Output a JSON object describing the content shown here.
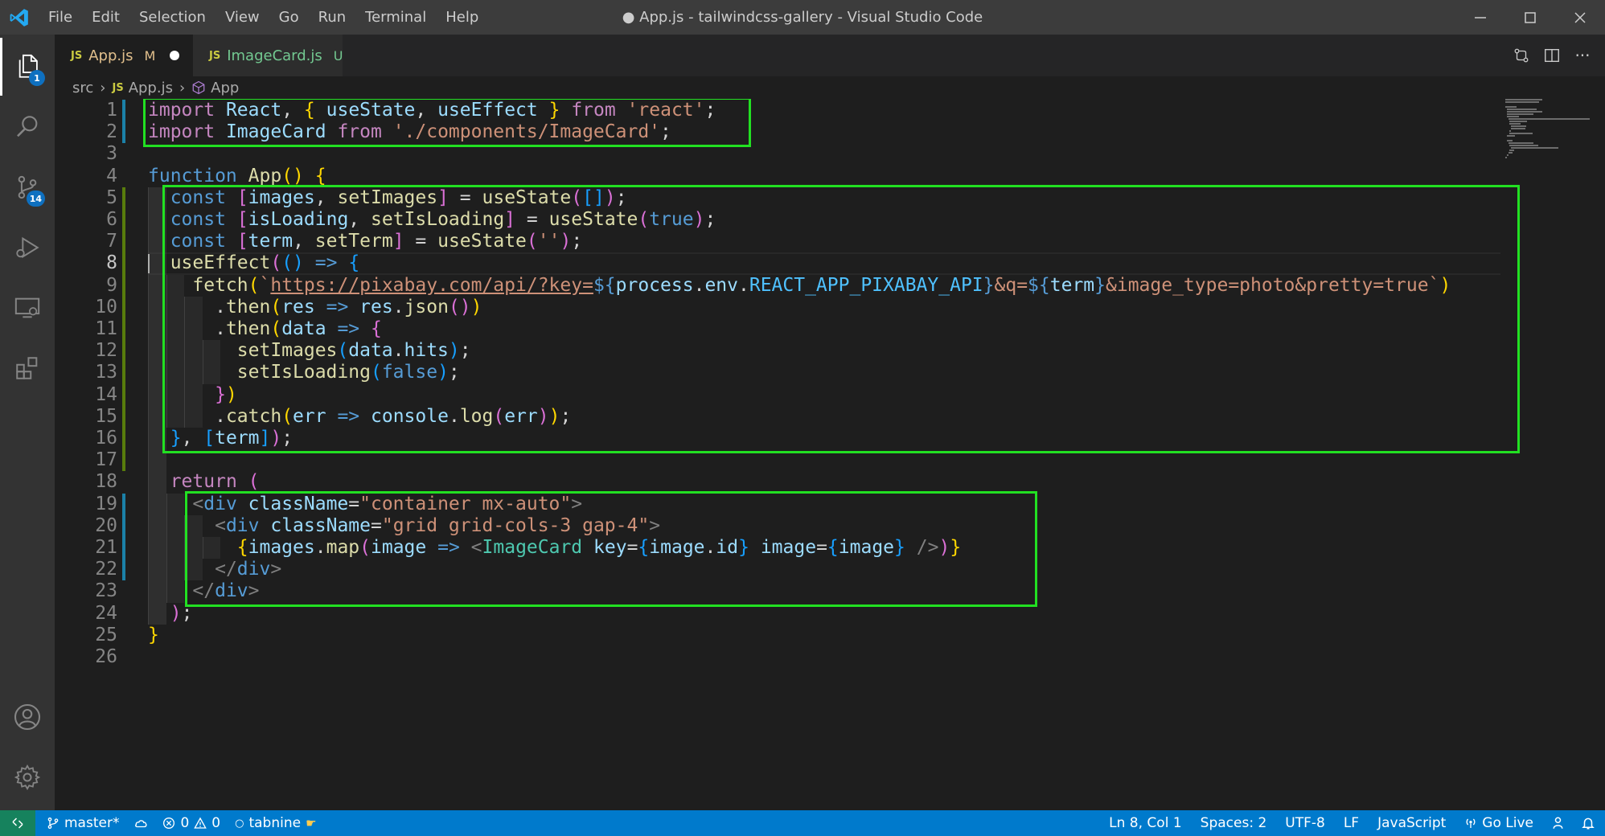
{
  "window": {
    "title": "● App.js - tailwindcss-gallery - Visual Studio Code"
  },
  "menu": [
    "File",
    "Edit",
    "Selection",
    "View",
    "Go",
    "Run",
    "Terminal",
    "Help"
  ],
  "activity_bar": {
    "explorer_badge": "1",
    "source_control_badge": "14",
    "items": [
      "explorer-icon",
      "search-icon",
      "source-control-icon",
      "run-debug-icon",
      "remote-explorer-icon",
      "extensions-icon",
      "account-icon",
      "manage-gear-icon"
    ]
  },
  "tabs": [
    {
      "icon": "JS",
      "label": "App.js",
      "status": "M",
      "dirty": true,
      "active": true
    },
    {
      "icon": "JS",
      "label": "ImageCard.js",
      "status": "U",
      "dirty": false,
      "active": false
    }
  ],
  "tab_actions": {
    "more": "···"
  },
  "breadcrumb": {
    "folder": "src",
    "file_icon": "JS",
    "file": "App.js",
    "symbol": "App"
  },
  "editor": {
    "line_numbers": [
      "1",
      "2",
      "3",
      "4",
      "5",
      "6",
      "7",
      "8",
      "9",
      "10",
      "11",
      "12",
      "13",
      "14",
      "15",
      "16",
      "17",
      "18",
      "19",
      "20",
      "21",
      "22",
      "23",
      "24",
      "25",
      "26"
    ],
    "current_line": 8,
    "lines": [
      [
        [
          "ctl",
          "import"
        ],
        [
          "pun",
          " "
        ],
        [
          "var",
          "React"
        ],
        [
          "pun",
          ", "
        ],
        [
          "brk1",
          "{"
        ],
        [
          "pun",
          " "
        ],
        [
          "var",
          "useState"
        ],
        [
          "pun",
          ", "
        ],
        [
          "var",
          "useEffect"
        ],
        [
          "pun",
          " "
        ],
        [
          "brk1",
          "}"
        ],
        [
          "pun",
          " "
        ],
        [
          "ctl",
          "from"
        ],
        [
          "pun",
          " "
        ],
        [
          "str",
          "'react'"
        ],
        [
          "pun",
          ";"
        ]
      ],
      [
        [
          "ctl",
          "import"
        ],
        [
          "pun",
          " "
        ],
        [
          "var",
          "ImageCard"
        ],
        [
          "pun",
          " "
        ],
        [
          "ctl",
          "from"
        ],
        [
          "pun",
          " "
        ],
        [
          "str",
          "'./components/ImageCard'"
        ],
        [
          "pun",
          ";"
        ]
      ],
      [],
      [
        [
          "kw",
          "function"
        ],
        [
          "pun",
          " "
        ],
        [
          "fn",
          "App"
        ],
        [
          "brk1",
          "()"
        ],
        [
          "pun",
          " "
        ],
        [
          "brk1",
          "{"
        ]
      ],
      [
        [
          "pun",
          "  "
        ],
        [
          "kw",
          "const"
        ],
        [
          "pun",
          " "
        ],
        [
          "brk2",
          "["
        ],
        [
          "var",
          "images"
        ],
        [
          "pun",
          ", "
        ],
        [
          "fn",
          "setImages"
        ],
        [
          "brk2",
          "]"
        ],
        [
          "pun",
          " = "
        ],
        [
          "fn",
          "useState"
        ],
        [
          "brk2",
          "("
        ],
        [
          "brk3",
          "[]"
        ],
        [
          "brk2",
          ")"
        ],
        [
          "pun",
          ";"
        ]
      ],
      [
        [
          "pun",
          "  "
        ],
        [
          "kw",
          "const"
        ],
        [
          "pun",
          " "
        ],
        [
          "brk2",
          "["
        ],
        [
          "var",
          "isLoading"
        ],
        [
          "pun",
          ", "
        ],
        [
          "fn",
          "setIsLoading"
        ],
        [
          "brk2",
          "]"
        ],
        [
          "pun",
          " = "
        ],
        [
          "fn",
          "useState"
        ],
        [
          "brk2",
          "("
        ],
        [
          "kw",
          "true"
        ],
        [
          "brk2",
          ")"
        ],
        [
          "pun",
          ";"
        ]
      ],
      [
        [
          "pun",
          "  "
        ],
        [
          "kw",
          "const"
        ],
        [
          "pun",
          " "
        ],
        [
          "brk2",
          "["
        ],
        [
          "var",
          "term"
        ],
        [
          "pun",
          ", "
        ],
        [
          "fn",
          "setTerm"
        ],
        [
          "brk2",
          "]"
        ],
        [
          "pun",
          " = "
        ],
        [
          "fn",
          "useState"
        ],
        [
          "brk2",
          "("
        ],
        [
          "str",
          "''"
        ],
        [
          "brk2",
          ")"
        ],
        [
          "pun",
          ";"
        ]
      ],
      [
        [
          "pun",
          "  "
        ],
        [
          "fn",
          "useEffect"
        ],
        [
          "brk2",
          "("
        ],
        [
          "brk3",
          "()"
        ],
        [
          "pun",
          " "
        ],
        [
          "kw",
          "=>"
        ],
        [
          "pun",
          " "
        ],
        [
          "brk3",
          "{"
        ]
      ],
      [
        [
          "pun",
          "    "
        ],
        [
          "fn",
          "fetch"
        ],
        [
          "brk1",
          "("
        ],
        [
          "str",
          "`"
        ],
        [
          "str url",
          "https://pixabay.com/api/?key="
        ],
        [
          "kw",
          "${"
        ],
        [
          "var",
          "process"
        ],
        [
          "pun",
          "."
        ],
        [
          "var",
          "env"
        ],
        [
          "pun",
          "."
        ],
        [
          "cst",
          "REACT_APP_PIXABAY_API"
        ],
        [
          "kw",
          "}"
        ],
        [
          "str",
          "&q="
        ],
        [
          "kw",
          "${"
        ],
        [
          "var",
          "term"
        ],
        [
          "kw",
          "}"
        ],
        [
          "str",
          "&image_type=photo&pretty=true"
        ],
        [
          "str",
          "`"
        ],
        [
          "brk1",
          ")"
        ]
      ],
      [
        [
          "pun",
          "      ."
        ],
        [
          "fn",
          "then"
        ],
        [
          "brk1",
          "("
        ],
        [
          "var",
          "res"
        ],
        [
          "pun",
          " "
        ],
        [
          "kw",
          "=>"
        ],
        [
          "pun",
          " "
        ],
        [
          "var",
          "res"
        ],
        [
          "pun",
          "."
        ],
        [
          "fn",
          "json"
        ],
        [
          "brk2",
          "()"
        ],
        [
          "brk1",
          ")"
        ]
      ],
      [
        [
          "pun",
          "      ."
        ],
        [
          "fn",
          "then"
        ],
        [
          "brk1",
          "("
        ],
        [
          "var",
          "data"
        ],
        [
          "pun",
          " "
        ],
        [
          "kw",
          "=>"
        ],
        [
          "pun",
          " "
        ],
        [
          "brk2",
          "{"
        ]
      ],
      [
        [
          "pun",
          "        "
        ],
        [
          "fn",
          "setImages"
        ],
        [
          "brk3",
          "("
        ],
        [
          "var",
          "data"
        ],
        [
          "pun",
          "."
        ],
        [
          "var",
          "hits"
        ],
        [
          "brk3",
          ")"
        ],
        [
          "pun",
          ";"
        ]
      ],
      [
        [
          "pun",
          "        "
        ],
        [
          "fn",
          "setIsLoading"
        ],
        [
          "brk3",
          "("
        ],
        [
          "kw",
          "false"
        ],
        [
          "brk3",
          ")"
        ],
        [
          "pun",
          ";"
        ]
      ],
      [
        [
          "pun",
          "      "
        ],
        [
          "brk2",
          "}"
        ],
        [
          "brk1",
          ")"
        ]
      ],
      [
        [
          "pun",
          "      ."
        ],
        [
          "fn",
          "catch"
        ],
        [
          "brk1",
          "("
        ],
        [
          "var",
          "err"
        ],
        [
          "pun",
          " "
        ],
        [
          "kw",
          "=>"
        ],
        [
          "pun",
          " "
        ],
        [
          "var",
          "console"
        ],
        [
          "pun",
          "."
        ],
        [
          "fn",
          "log"
        ],
        [
          "brk2",
          "("
        ],
        [
          "var",
          "err"
        ],
        [
          "brk2",
          ")"
        ],
        [
          "brk1",
          ")"
        ],
        [
          "pun",
          ";"
        ]
      ],
      [
        [
          "pun",
          "  "
        ],
        [
          "brk3",
          "}"
        ],
        [
          "pun",
          ", "
        ],
        [
          "brk3",
          "["
        ],
        [
          "var",
          "term"
        ],
        [
          "brk3",
          "]"
        ],
        [
          "brk2",
          ")"
        ],
        [
          "pun",
          ";"
        ]
      ],
      [],
      [
        [
          "pun",
          "  "
        ],
        [
          "ctl",
          "return"
        ],
        [
          "pun",
          " "
        ],
        [
          "brk2",
          "("
        ]
      ],
      [
        [
          "pun",
          "    "
        ],
        [
          "tagp",
          "<"
        ],
        [
          "tag",
          "div"
        ],
        [
          "pun",
          " "
        ],
        [
          "attr",
          "className"
        ],
        [
          "pun",
          "="
        ],
        [
          "str",
          "\"container mx-auto\""
        ],
        [
          "tagp",
          ">"
        ]
      ],
      [
        [
          "pun",
          "      "
        ],
        [
          "tagp",
          "<"
        ],
        [
          "tag",
          "div"
        ],
        [
          "pun",
          " "
        ],
        [
          "attr",
          "className"
        ],
        [
          "pun",
          "="
        ],
        [
          "str",
          "\"grid grid-cols-3 gap-4\""
        ],
        [
          "tagp",
          ">"
        ]
      ],
      [
        [
          "pun",
          "        "
        ],
        [
          "brk1",
          "{"
        ],
        [
          "var",
          "images"
        ],
        [
          "pun",
          "."
        ],
        [
          "fn",
          "map"
        ],
        [
          "brk2",
          "("
        ],
        [
          "var",
          "image"
        ],
        [
          "pun",
          " "
        ],
        [
          "kw",
          "=>"
        ],
        [
          "pun",
          " "
        ],
        [
          "tagp",
          "<"
        ],
        [
          "comp",
          "ImageCard"
        ],
        [
          "pun",
          " "
        ],
        [
          "attr",
          "key"
        ],
        [
          "pun",
          "="
        ],
        [
          "brk3",
          "{"
        ],
        [
          "var",
          "image"
        ],
        [
          "pun",
          "."
        ],
        [
          "var",
          "id"
        ],
        [
          "brk3",
          "}"
        ],
        [
          "pun",
          " "
        ],
        [
          "attr",
          "image"
        ],
        [
          "pun",
          "="
        ],
        [
          "brk3",
          "{"
        ],
        [
          "var",
          "image"
        ],
        [
          "brk3",
          "}"
        ],
        [
          "pun",
          " "
        ],
        [
          "tagp",
          "/>"
        ],
        [
          "brk2",
          ")"
        ],
        [
          "brk1",
          "}"
        ]
      ],
      [
        [
          "pun",
          "      "
        ],
        [
          "tagp",
          "</"
        ],
        [
          "tag",
          "div"
        ],
        [
          "tagp",
          ">"
        ]
      ],
      [
        [
          "pun",
          "    "
        ],
        [
          "tagp",
          "</"
        ],
        [
          "tag",
          "div"
        ],
        [
          "tagp",
          ">"
        ]
      ],
      [
        [
          "pun",
          "  "
        ],
        [
          "brk2",
          ")"
        ],
        [
          "pun",
          ";"
        ]
      ],
      [
        [
          "brk1",
          "}"
        ]
      ],
      []
    ]
  },
  "status_bar": {
    "branch": "master*",
    "errors": "0",
    "warnings": "0",
    "tabnine": "tabnine",
    "position": "Ln 8, Col 1",
    "spaces": "Spaces: 2",
    "encoding": "UTF-8",
    "eol": "LF",
    "language": "JavaScript",
    "go_live": "Go Live"
  },
  "colors": {
    "highlight_box": "#22e022",
    "statusbar": "#007acc",
    "remote": "#16825d"
  }
}
